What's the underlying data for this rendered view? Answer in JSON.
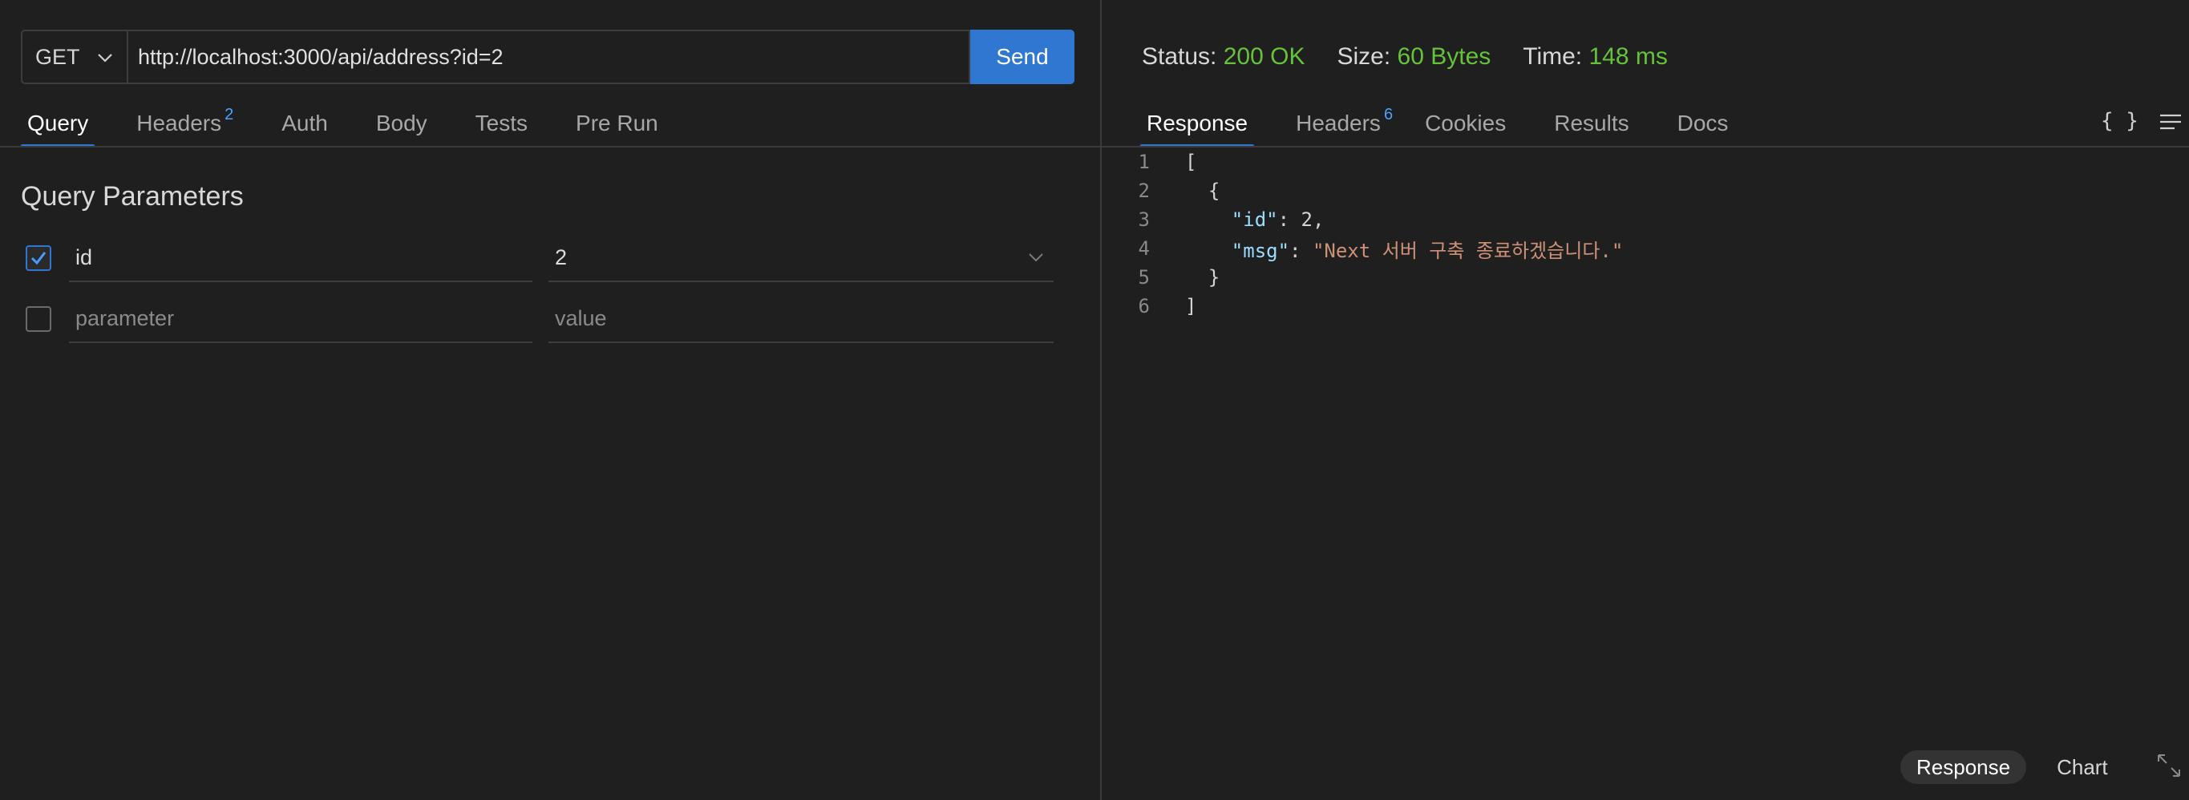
{
  "request": {
    "method": "GET",
    "url": "http://localhost:3000/api/address?id=2",
    "send_label": "Send"
  },
  "request_tabs": [
    {
      "label": "Query",
      "badge": ""
    },
    {
      "label": "Headers",
      "badge": "2"
    },
    {
      "label": "Auth",
      "badge": ""
    },
    {
      "label": "Body",
      "badge": ""
    },
    {
      "label": "Tests",
      "badge": ""
    },
    {
      "label": "Pre Run",
      "badge": ""
    }
  ],
  "query": {
    "title": "Query Parameters",
    "params": [
      {
        "checked": true,
        "name": "id",
        "value": "2"
      }
    ],
    "new_param": {
      "name_placeholder": "parameter",
      "value_placeholder": "value"
    }
  },
  "response": {
    "status_label": "Status:",
    "status_value": "200 OK",
    "size_label": "Size:",
    "size_value": "60 Bytes",
    "time_label": "Time:",
    "time_value": "148 ms",
    "tabs": [
      {
        "label": "Response",
        "badge": ""
      },
      {
        "label": "Headers",
        "badge": "6"
      },
      {
        "label": "Cookies",
        "badge": ""
      },
      {
        "label": "Results",
        "badge": ""
      },
      {
        "label": "Docs",
        "badge": ""
      }
    ],
    "format_icon": "{ }",
    "body_lines": [
      {
        "n": "1",
        "text": "["
      },
      {
        "n": "2",
        "text": "  {"
      },
      {
        "n": "3",
        "key": "\"id\"",
        "sep": ": ",
        "num": "2",
        "tail": ","
      },
      {
        "n": "4",
        "key": "\"msg\"",
        "sep": ": ",
        "str": "\"Next 서버 구축 종료하겠습니다.\""
      },
      {
        "n": "5",
        "text": "  }"
      },
      {
        "n": "6",
        "text": "]"
      }
    ],
    "bottom": {
      "response_label": "Response",
      "chart_label": "Chart"
    }
  },
  "colors": {
    "accent": "#2f77d1",
    "success": "#67c23a",
    "background": "#1f1f1f"
  }
}
